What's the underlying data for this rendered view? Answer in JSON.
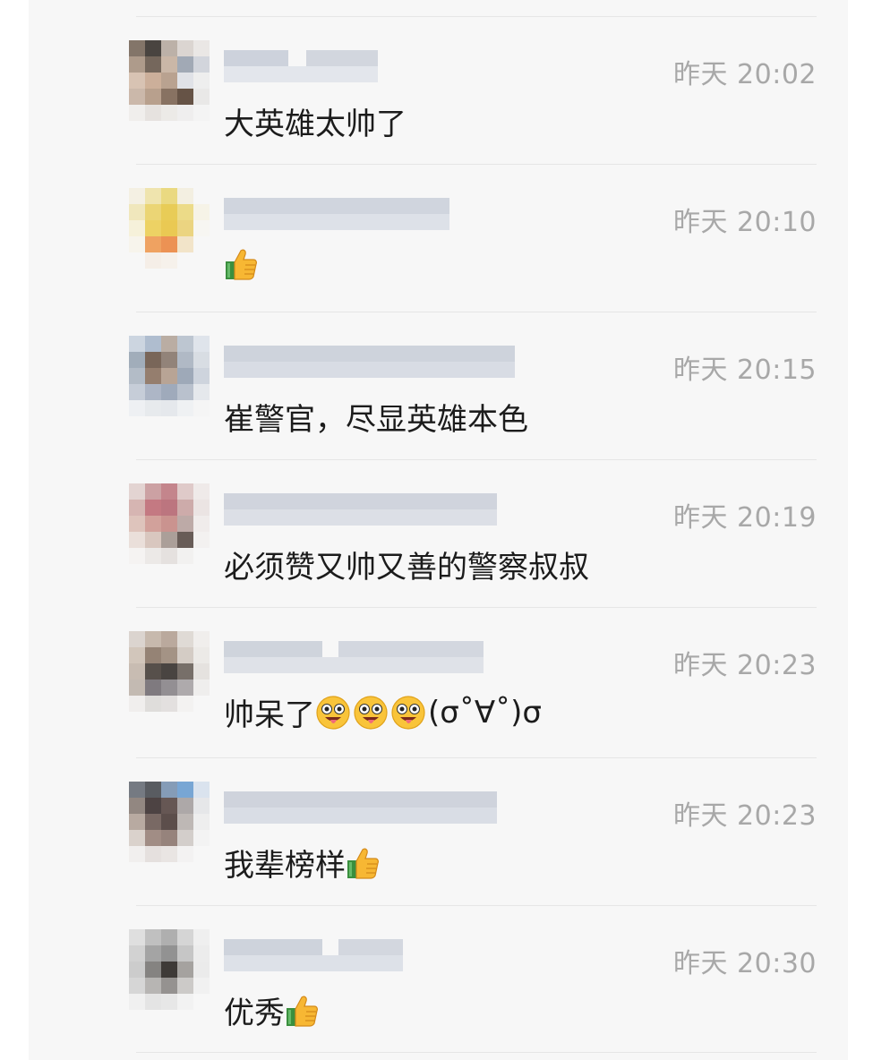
{
  "colors": {
    "background": "#f7f7f7",
    "divider": "#e6e6e6",
    "timestamp": "#a8a8a8",
    "text": "#1c1c1c"
  },
  "comments": [
    {
      "time": "昨天 20:02",
      "text": "大英雄太帅了",
      "emojis": []
    },
    {
      "time": "昨天 20:10",
      "text": "",
      "emojis": [
        "thumbs-up"
      ]
    },
    {
      "time": "昨天 20:15",
      "text": "崔警官，尽显英雄本色",
      "emojis": []
    },
    {
      "time": "昨天 20:19",
      "text": "必须赞又帅又善的警察叔叔",
      "emojis": []
    },
    {
      "time": "昨天 20:23",
      "text": "帅呆了",
      "emojis": [
        "drooling-face",
        "drooling-face",
        "drooling-face"
      ],
      "suffix": "(σ˚∀˚)σ"
    },
    {
      "time": "昨天 20:23",
      "text": "我辈榜样",
      "emojis": [
        "thumbs-up"
      ]
    },
    {
      "time": "昨天 20:30",
      "text": "优秀",
      "emojis": [
        "thumbs-up"
      ]
    }
  ]
}
